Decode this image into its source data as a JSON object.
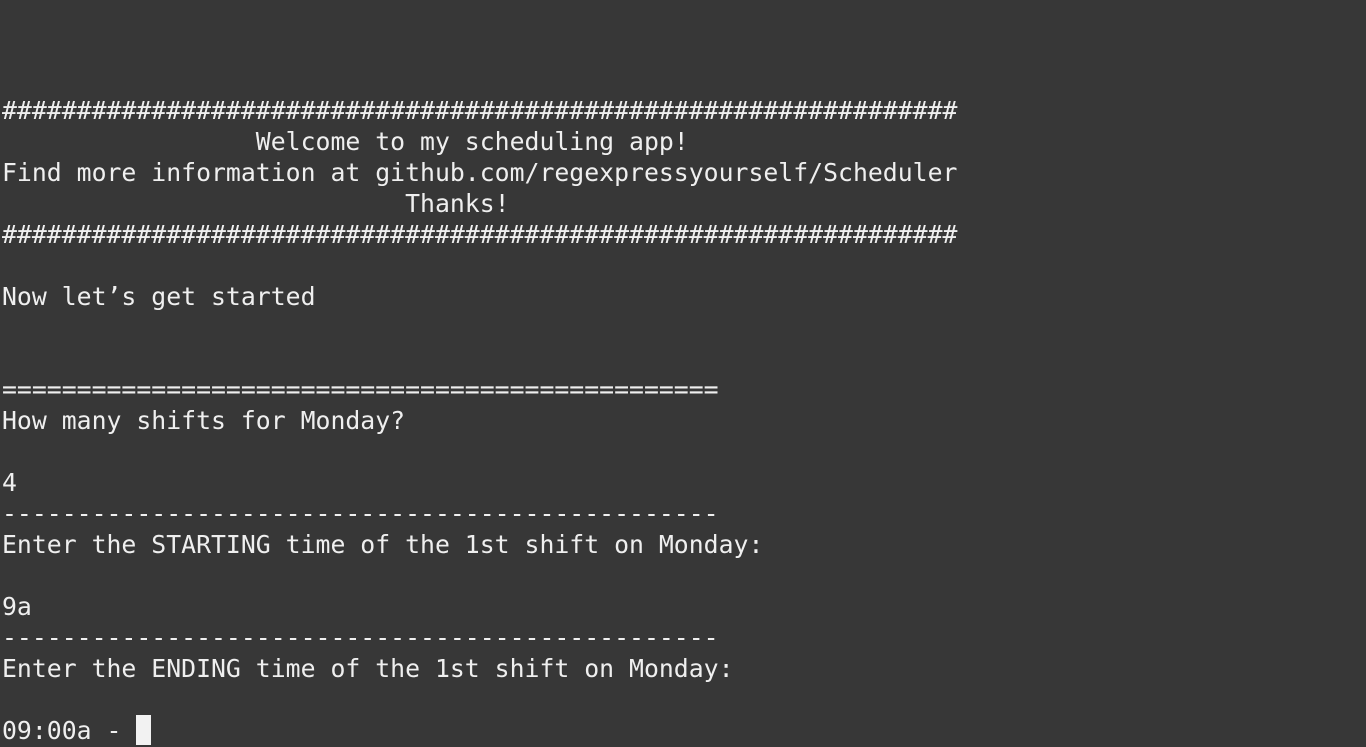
{
  "banner": {
    "border_top": "################################################################",
    "welcome": "                 Welcome to my scheduling app!",
    "info": "Find more information at github.com/regexpressyourself/Scheduler",
    "thanks": "                           Thanks!",
    "border_bottom": "################################################################"
  },
  "intro": "Now let’s get started",
  "section_rule": "================================================",
  "q_shifts": {
    "prompt": "How many shifts for Monday?",
    "answer": "4"
  },
  "rule_1": "------------------------------------------------",
  "q_start": {
    "prompt": "Enter the STARTING time of the 1st shift on Monday:",
    "answer": "9a"
  },
  "rule_2": "------------------------------------------------",
  "q_end": {
    "prompt": "Enter the ENDING time of the 1st shift on Monday:",
    "input": "09:00a - "
  },
  "colors": {
    "background": "#373737",
    "text": "#efefef",
    "cursor": "#f2f2f2"
  }
}
